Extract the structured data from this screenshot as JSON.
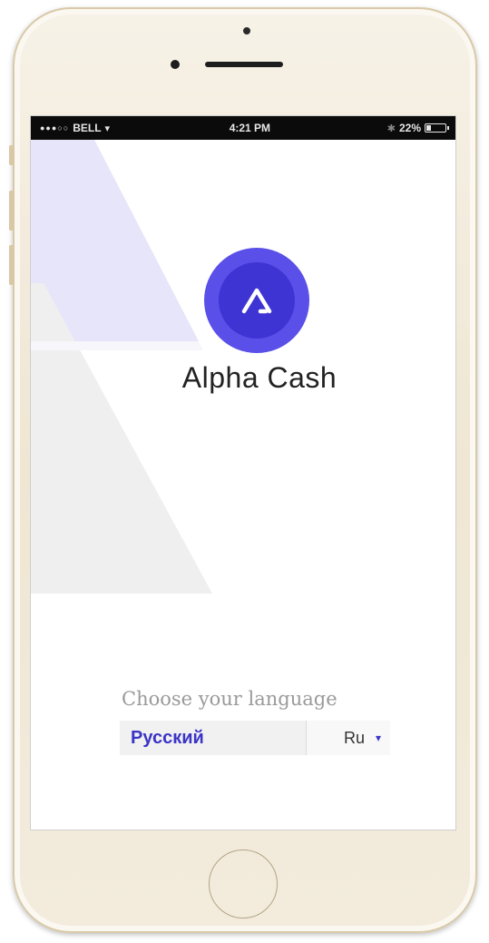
{
  "status_bar": {
    "carrier": "BELL",
    "time": "4:21 PM",
    "battery": "22%",
    "battery_level": 0.22
  },
  "app": {
    "name": "Alpha Cash",
    "logo_icon": "alpha-triangle-icon",
    "colors": {
      "logo_outer": "#5a4fe8",
      "logo_inner": "#3e34d4",
      "accent_text": "#3b34c7",
      "decor_lavender": "#e7e5f9",
      "decor_gray": "#efefef"
    }
  },
  "language": {
    "label": "Choose your language",
    "selected_name": "Русский",
    "selected_code": "Ru"
  }
}
